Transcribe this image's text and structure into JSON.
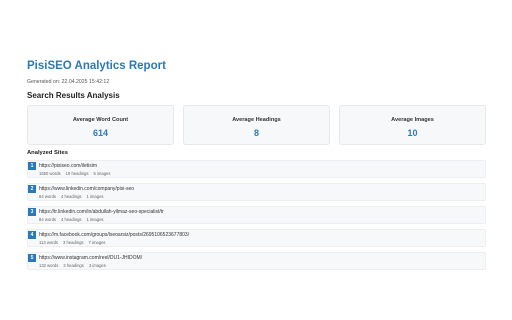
{
  "report": {
    "title": "PisiSEO Analytics Report",
    "generated": "Generated on: 22.04.2025 15:42:12",
    "section_heading": "Search Results Analysis"
  },
  "cards": [
    {
      "label": "Average Word Count",
      "value": "614"
    },
    {
      "label": "Average Headings",
      "value": "8"
    },
    {
      "label": "Average Images",
      "value": "10"
    }
  ],
  "analyzed": {
    "heading": "Analyzed Sites",
    "sites": [
      {
        "num": "1",
        "url": "https://pisiseo.com/iletisim",
        "words": "1550 words",
        "headings": "19 headings",
        "images": "5 images"
      },
      {
        "num": "2",
        "url": "https://www.linkedin.com/company/pisi-seo",
        "words": "84 words",
        "headings": "4 headings",
        "images": "1 images"
      },
      {
        "num": "3",
        "url": "https://tr.linkedin.com/in/abdullah-yilmaz-seo-specialist/tr",
        "words": "84 words",
        "headings": "4 headings",
        "images": "1 images"
      },
      {
        "num": "4",
        "url": "https://m.facebook.com/groups/lseoarsiz/posts/2695106523677803/",
        "words": "113 words",
        "headings": "3 headings",
        "images": "7 images"
      },
      {
        "num": "5",
        "url": "https://www.instagram.com/reel/DU1-JHIDOM/",
        "words": "132 words",
        "headings": "2 headings",
        "images": "3 images"
      }
    ]
  },
  "colors": {
    "accent": "#2a7ab8",
    "card_bg": "#f7f8fa",
    "border": "#e6e8eb"
  }
}
